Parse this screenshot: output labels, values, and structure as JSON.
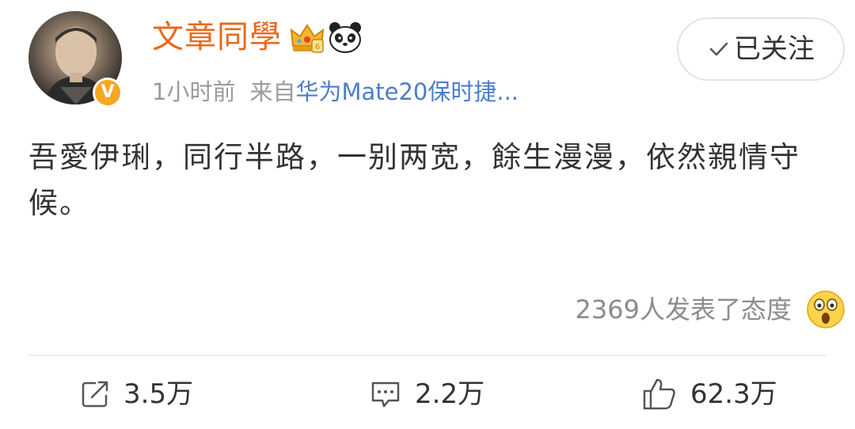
{
  "post": {
    "username": "文章同學",
    "badges": [
      "crown-icon",
      "panda-icon"
    ],
    "verified_mark": "V",
    "time": "1小时前",
    "source_prefix": "来自",
    "source_device": "华为Mate20保时捷...",
    "follow_label": "已关注",
    "text": "吾愛伊琍，同行半路，一别两宽，餘生漫漫，依然親情守候。",
    "attitude_text": "2369人发表了态度",
    "attitude_icon": "shocked-face-icon"
  },
  "actions": {
    "repost": {
      "icon": "share-icon",
      "count": "3.5万"
    },
    "comment": {
      "icon": "comment-icon",
      "count": "2.2万"
    },
    "like": {
      "icon": "thumbs-up-icon",
      "count": "62.3万"
    }
  },
  "colors": {
    "username": "#e86a1c",
    "source_link": "#4d7ec8",
    "meta": "#9b9b9b",
    "verified": "#f6a623"
  }
}
